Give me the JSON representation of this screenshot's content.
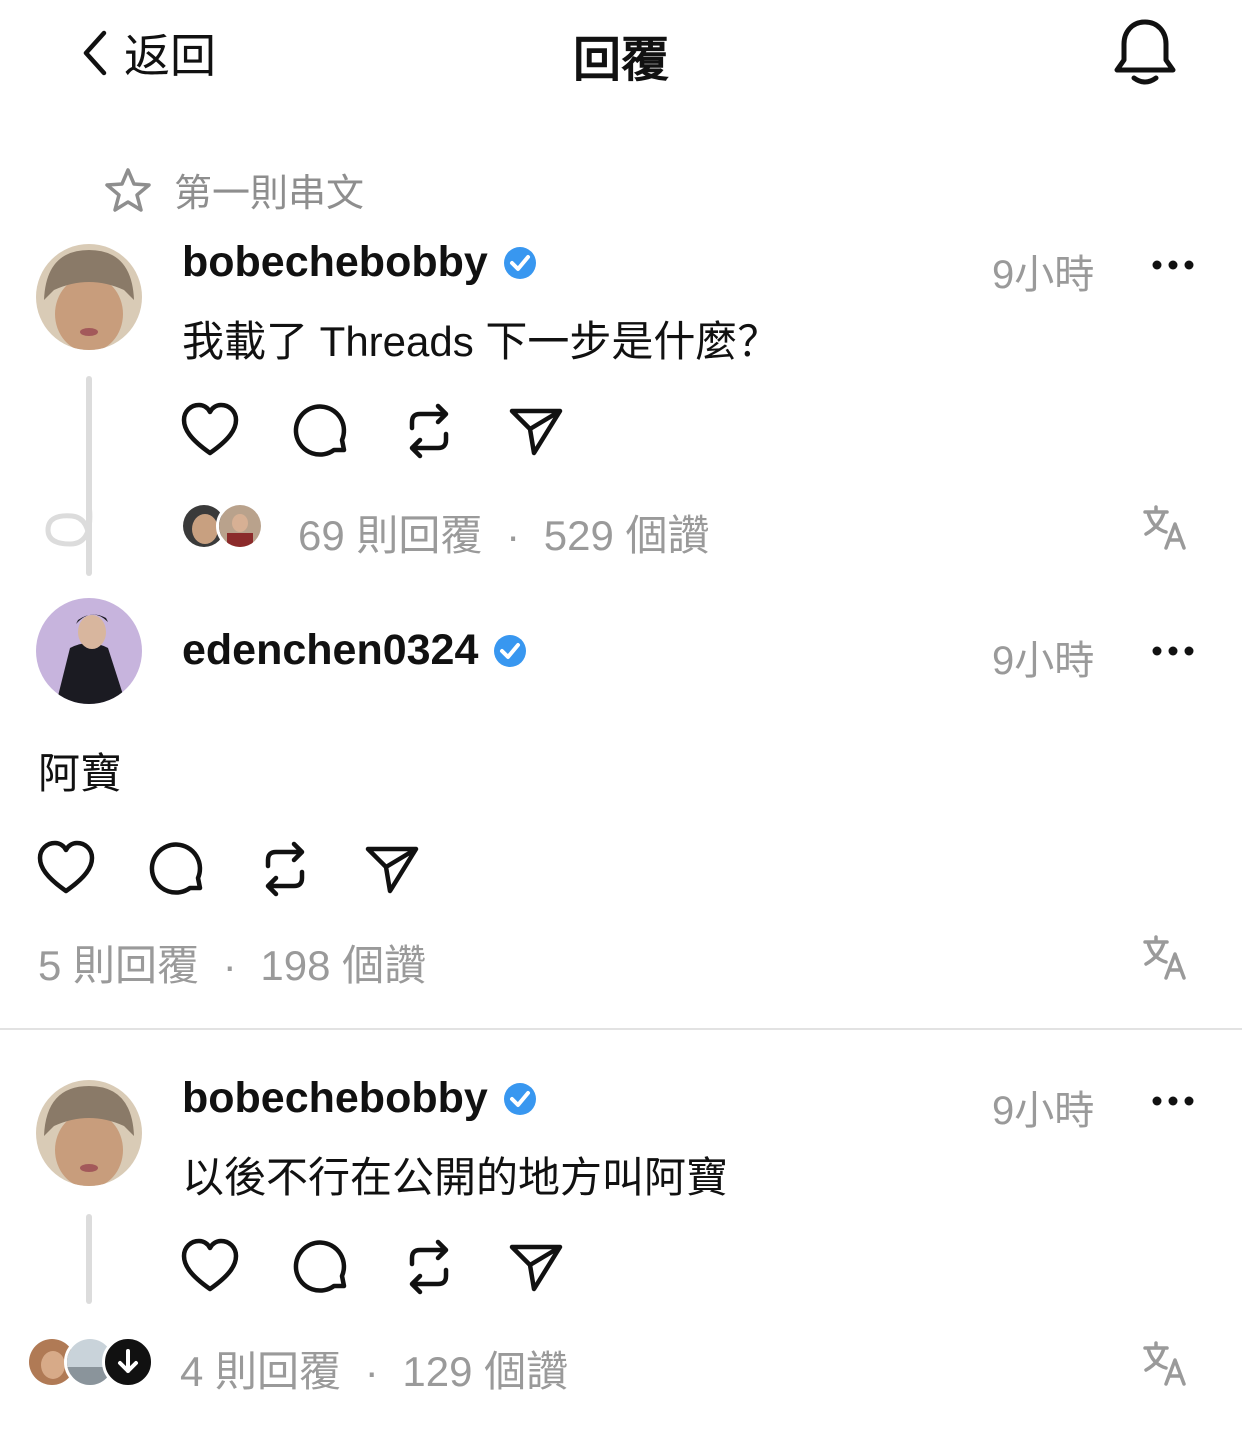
{
  "header": {
    "back_label": "返回",
    "title": "回覆"
  },
  "pinned": {
    "label": "第一則串文"
  },
  "posts": [
    {
      "username": "bobechebobby",
      "time": "9小時",
      "text": "我載了 Threads 下一步是什麼？",
      "replies": "69 則回覆",
      "likes": "529 個讚"
    },
    {
      "username": "edenchen0324",
      "time": "9小時",
      "text": "阿寶",
      "replies": "5 則回覆",
      "likes": "198 個讚"
    },
    {
      "username": "bobechebobby",
      "time": "9小時",
      "text": "以後不行在公開的地方叫阿寶",
      "replies": "4 則回覆",
      "likes": "129 個讚"
    }
  ],
  "separator": "·",
  "icons": [
    "chevron-left-icon",
    "bell-icon",
    "star-icon",
    "verified-badge-icon",
    "more-icon",
    "heart-icon",
    "comment-icon",
    "repost-icon",
    "share-icon",
    "translate-icon",
    "down-arrow-icon"
  ],
  "colors": {
    "verified": "#3897f0",
    "muted": "#9a9a9a",
    "divider": "#e2e2e2"
  }
}
